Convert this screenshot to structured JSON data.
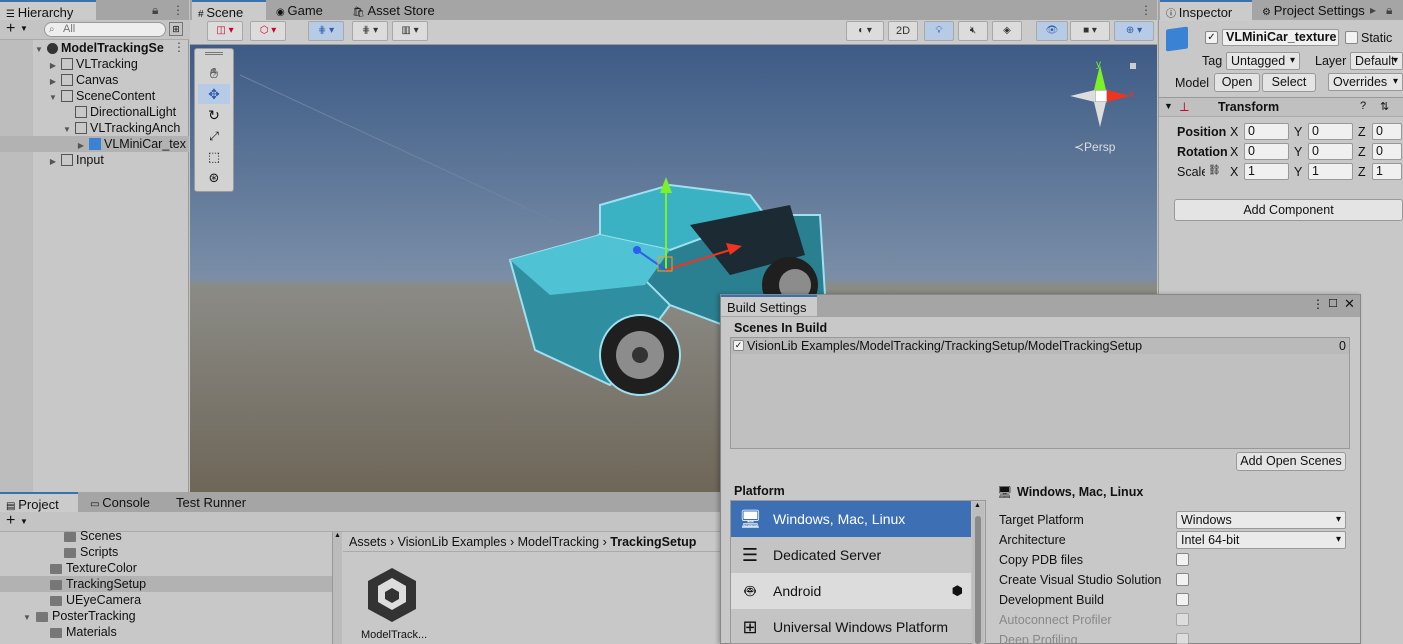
{
  "hierarchy": {
    "tab": "Hierarchy",
    "search_placeholder": "All",
    "items": [
      {
        "label": "ModelTrackingSe",
        "depth": 0,
        "arrow": "▼",
        "bold": true
      },
      {
        "label": "VLTracking",
        "depth": 1,
        "arrow": "▶"
      },
      {
        "label": "Canvas",
        "depth": 1,
        "arrow": "▶"
      },
      {
        "label": "SceneContent",
        "depth": 1,
        "arrow": "▼"
      },
      {
        "label": "DirectionalLight",
        "depth": 2,
        "arrow": ""
      },
      {
        "label": "VLTrackingAnch",
        "depth": 2,
        "arrow": "▼"
      },
      {
        "label": "VLMiniCar_tex",
        "depth": 3,
        "arrow": "▶",
        "selected": true
      },
      {
        "label": "Input",
        "depth": 1,
        "arrow": "▶"
      }
    ]
  },
  "scene_tabs": {
    "scene": "Scene",
    "game": "Game",
    "asset_store": "Asset Store"
  },
  "scene_toolbar": {
    "mode_2d": "2D"
  },
  "scene_view": {
    "persp": "≺Persp",
    "gizmo_y": "y",
    "gizmo_x": "x"
  },
  "inspector": {
    "tab": "Inspector",
    "tab2": "Project Settings",
    "object_name": "VLMiniCar_texture",
    "static_label": "Static",
    "tag_label": "Tag",
    "tag_value": "Untagged",
    "layer_label": "Layer",
    "layer_value": "Default",
    "model_label": "Model",
    "open_button": "Open",
    "select_button": "Select",
    "overrides_button": "Overrides",
    "transform_title": "Transform",
    "position_label": "Position",
    "rotation_label": "Rotation",
    "scale_label": "Scale",
    "x": "X",
    "y": "Y",
    "z": "Z",
    "position": [
      "0",
      "0",
      "0"
    ],
    "rotation": [
      "0",
      "0",
      "0"
    ],
    "scale": [
      "1",
      "1",
      "1"
    ],
    "add_component": "Add Component"
  },
  "bottom_tabs": {
    "project": "Project",
    "console": "Console",
    "test_runner": "Test Runner"
  },
  "project_tree": [
    {
      "label": "Scenes",
      "depth": 2
    },
    {
      "label": "Scripts",
      "depth": 2
    },
    {
      "label": "TextureColor",
      "depth": 1
    },
    {
      "label": "TrackingSetup",
      "depth": 1,
      "selected": true
    },
    {
      "label": "UEyeCamera",
      "depth": 1
    },
    {
      "label": "PosterTracking",
      "depth": 0,
      "arrow": "▼"
    },
    {
      "label": "Materials",
      "depth": 1
    }
  ],
  "breadcrumb": {
    "assets": "Assets",
    "vl": "VisionLib Examples",
    "mt": "ModelTracking",
    "ts": "TrackingSetup"
  },
  "asset_item": "ModelTrack...",
  "build": {
    "title": "Build Settings",
    "scenes_header": "Scenes In Build",
    "scene_path": "VisionLib Examples/ModelTracking/TrackingSetup/ModelTrackingSetup",
    "scene_index": "0",
    "add_open_scenes": "Add Open Scenes",
    "platform_header": "Platform",
    "platforms": [
      "Windows, Mac, Linux",
      "Dedicated Server",
      "Android",
      "Universal Windows Platform"
    ],
    "selected_platform_title": "Windows, Mac, Linux",
    "settings": [
      {
        "label": "Target Platform",
        "value": "Windows",
        "kind": "dropdown"
      },
      {
        "label": "Architecture",
        "value": "Intel 64-bit",
        "kind": "dropdown"
      },
      {
        "label": "Copy PDB files",
        "kind": "checkbox"
      },
      {
        "label": "Create Visual Studio Solution",
        "kind": "checkbox"
      },
      {
        "label": "Development Build",
        "kind": "checkbox"
      },
      {
        "label": "Autoconnect Profiler",
        "kind": "checkbox",
        "disabled": true
      },
      {
        "label": "Deep Profiling",
        "kind": "checkbox",
        "disabled": true
      }
    ]
  }
}
